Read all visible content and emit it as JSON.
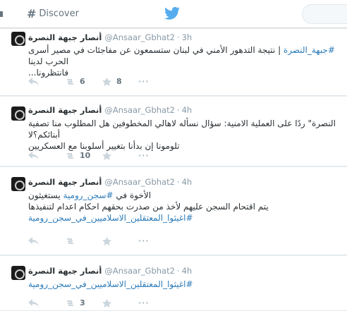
{
  "nav": {
    "discover_label": "Discover"
  },
  "tweets": [
    {
      "name": "أنصار جبهة النصرة",
      "handle": "@Ansaar_Gbhat2",
      "time": "3h",
      "line1_tag": "#جبهة_النصرة",
      "line1_rest": " | نتيجة التدهور الأمني في لبنان ستسمعون عن مفاجئات في مصير أسرى الحرب لدينا",
      "line2": "فانتظرونا...",
      "retweets": "6",
      "likes": "8"
    },
    {
      "name": "أنصار جبهة النصرة",
      "handle": "@Ansaar_Gbhat2",
      "time": "4h",
      "line1": "النصرة\" ردًا على العملية الامنية: سؤال نسأله لاهالي المخطوفين هل المطلوب منا تصفية أبنائكم؟لا",
      "line2": "تلومونا إن بدأنا بتغيير أسلوبنا مع العسكريين",
      "retweets": "10",
      "likes": ""
    },
    {
      "name": "أنصار جبهة النصرة",
      "handle": "@Ansaar_Gbhat2",
      "time": "4h",
      "line1_pre": "الأخوة في ",
      "line1_tag": "#سجن_رومية",
      "line1_post": " يستغيثون",
      "line2": "يتم اقتحام السجن عليهم لأخذ من صدرت بحقهم احكام اعدام لتنفيذها",
      "line3_tag": "#اغيثوا_المعتقلين_الاسلاميين_في_سجن_رومية",
      "retweets": "",
      "likes": ""
    },
    {
      "name": "أنصار جبهة النصرة",
      "handle": "@Ansaar_Gbhat2",
      "time": "4h",
      "line1_tag": "#اغيثوا_المعتقلين_الاسلاميين_في_سجن_رومية",
      "retweets": "3",
      "likes": ""
    }
  ],
  "icons": [
    "hashtag-icon",
    "twitter-bird-icon",
    "reply-icon",
    "retweet-icon",
    "like-icon",
    "more-icon"
  ],
  "colors": {
    "link": "#2b7bb9",
    "muted": "#8899a6",
    "brand": "#55acee"
  }
}
